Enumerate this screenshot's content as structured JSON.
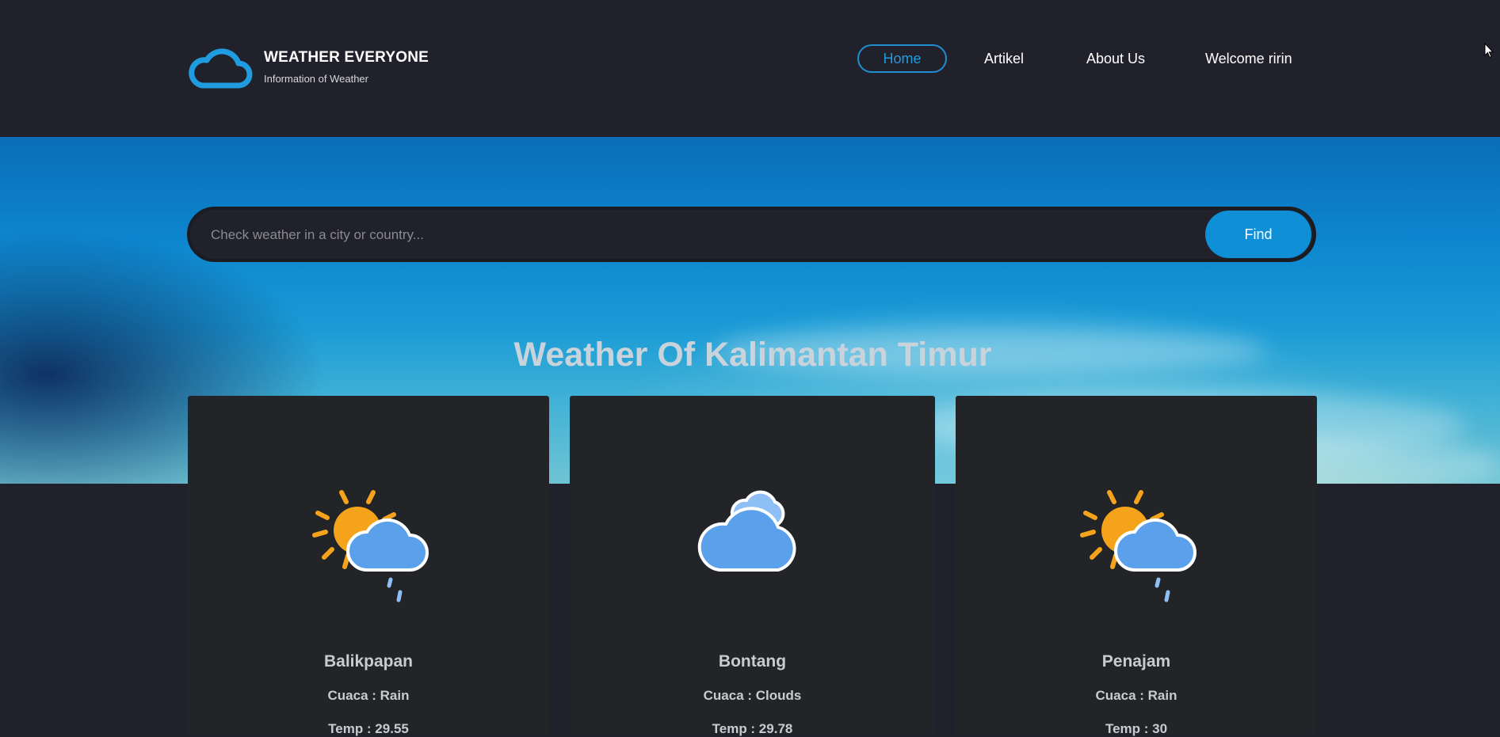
{
  "brand": {
    "title": "WEATHER EVERYONE",
    "subtitle": "Information of Weather",
    "logo_icon": "cloud-logo-icon",
    "accent_color": "#1d8fd1"
  },
  "nav": {
    "home": "Home",
    "artikel": "Artikel",
    "about": "About Us",
    "welcome": "Welcome ririn"
  },
  "search": {
    "placeholder": "Check weather in a city or country...",
    "button": "Find"
  },
  "section_title": "Weather Of Kalimantan Timur",
  "cards": [
    {
      "city": "Balikpapan",
      "cuaca": "Cuaca : Rain",
      "temp": "Temp : 29.55",
      "icon": "sun-cloud-rain-icon"
    },
    {
      "city": "Bontang",
      "cuaca": "Cuaca : Clouds",
      "temp": "Temp : 29.78",
      "icon": "clouds-icon"
    },
    {
      "city": "Penajam",
      "cuaca": "Cuaca : Rain",
      "temp": "Temp : 30",
      "icon": "sun-cloud-rain-icon"
    }
  ]
}
